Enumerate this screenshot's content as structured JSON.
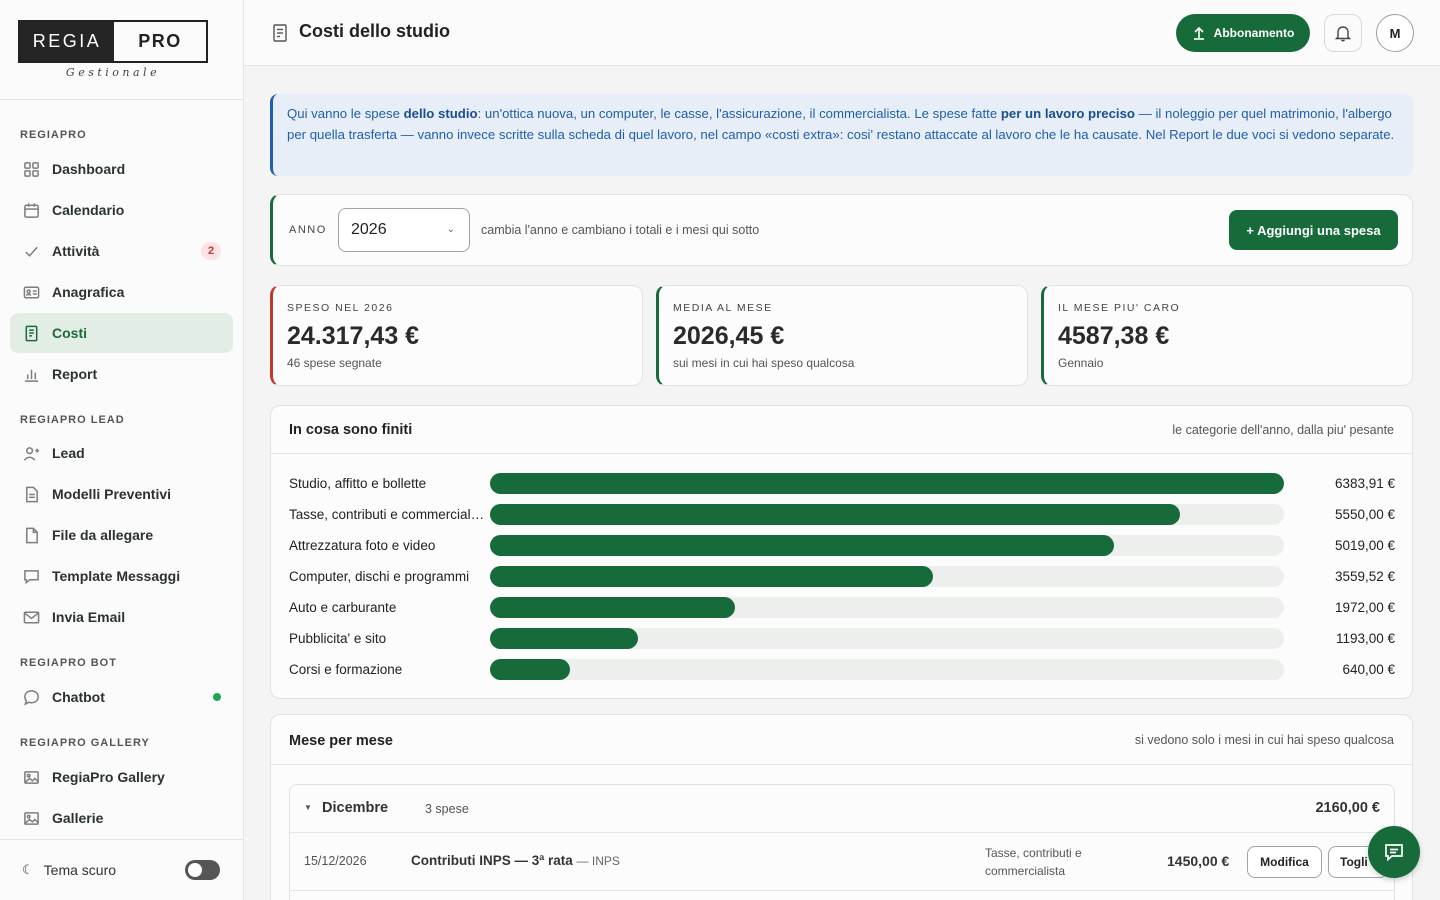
{
  "logo": {
    "left": "REGIA",
    "right": "PRO",
    "sub": "Gestionale"
  },
  "sidebar": {
    "sections": [
      {
        "label": "REGIAPRO"
      },
      {
        "label": "REGIAPRO LEAD"
      },
      {
        "label": "REGIAPRO BOT"
      },
      {
        "label": "REGIAPRO GALLERY"
      }
    ],
    "items": [
      {
        "label": "Dashboard",
        "icon": "grid-icon"
      },
      {
        "label": "Calendario",
        "icon": "calendar-icon"
      },
      {
        "label": "Attività",
        "icon": "check-icon",
        "badge": "2"
      },
      {
        "label": "Anagrafica",
        "icon": "id-card-icon"
      },
      {
        "label": "Costi",
        "icon": "receipt-icon",
        "active": true
      },
      {
        "label": "Report",
        "icon": "bar-chart-icon"
      },
      {
        "label": "Lead",
        "icon": "user-plus-icon"
      },
      {
        "label": "Modelli Preventivi",
        "icon": "document-icon"
      },
      {
        "label": "File da allegare",
        "icon": "file-icon"
      },
      {
        "label": "Template Messaggi",
        "icon": "message-square-icon"
      },
      {
        "label": "Invia Email",
        "icon": "mail-icon"
      },
      {
        "label": "Chatbot",
        "icon": "chat-bubble-icon",
        "status": "online"
      },
      {
        "label": "RegiaPro Gallery",
        "icon": "image-icon"
      },
      {
        "label": "Gallerie",
        "icon": "images-icon"
      }
    ],
    "theme_label": "Tema scuro"
  },
  "header": {
    "title": "Costi dello studio",
    "subscribe_label": "Abbonamento",
    "avatar_initial": "M"
  },
  "info": {
    "p1": "Qui vanno le spese ",
    "b1": "dello studio",
    "p2": ": un'ottica nuova, un computer, le casse, l'assicurazione, il commercialista. Le spese fatte ",
    "b2": "per un lavoro preciso",
    "p3": " — il noleggio per quel matrimonio, l'albergo per quella trasferta — vanno invece scritte sulla scheda di quel lavoro, nel campo «costi extra»: cosi' restano attaccate al lavoro che le ha causate. Nel Report le due voci si vedono separate."
  },
  "year": {
    "label": "ANNO",
    "value": "2026",
    "hint": "cambia l'anno e cambiano i totali e i mesi qui sotto",
    "add_label": "+ Aggiungi una spesa"
  },
  "stats": [
    {
      "label": "SPESO NEL 2026",
      "value": "24.317,43 €",
      "sub": "46 spese segnate",
      "accent": "#c0392b"
    },
    {
      "label": "MEDIA AL MESE",
      "value": "2026,45 €",
      "sub": "sui mesi in cui hai speso qualcosa",
      "accent": "#176b3a"
    },
    {
      "label": "IL MESE PIU' CARO",
      "value": "4587,38 €",
      "sub": "Gennaio",
      "accent": "#176b3a"
    }
  ],
  "categories": {
    "title": "In cosa sono finiti",
    "hint": "le categorie dell'anno, dalla piu' pesante",
    "items": [
      {
        "name": "Studio, affitto e bollette",
        "amount": "6383,91 €",
        "value": 6383.91
      },
      {
        "name": "Tasse, contributi e commercialista",
        "amount": "5550,00 €",
        "value": 5550.0
      },
      {
        "name": "Attrezzatura foto e video",
        "amount": "5019,00 €",
        "value": 5019.0
      },
      {
        "name": "Computer, dischi e programmi",
        "amount": "3559,52 €",
        "value": 3559.52
      },
      {
        "name": "Auto e carburante",
        "amount": "1972,00 €",
        "value": 1972.0
      },
      {
        "name": "Pubblicita' e sito",
        "amount": "1193,00 €",
        "value": 1193.0
      },
      {
        "name": "Corsi e formazione",
        "amount": "640,00 €",
        "value": 640.0
      }
    ]
  },
  "months": {
    "title": "Mese per mese",
    "hint": "si vedono solo i mesi in cui hai speso qualcosa",
    "month": {
      "name": "Dicembre",
      "count": "3 spese",
      "total": "2160,00 €",
      "expense": {
        "date": "15/12/2026",
        "title": "Contributi INPS — 3ª rata",
        "vendor": "— INPS",
        "category": "Tasse, contributi e commercialista",
        "amount": "1450,00 €",
        "edit_label": "Modifica",
        "remove_label": "Togli"
      }
    }
  },
  "colors": {
    "brand": "#176b3a",
    "info": "#1f5fae",
    "danger": "#c0392b"
  }
}
